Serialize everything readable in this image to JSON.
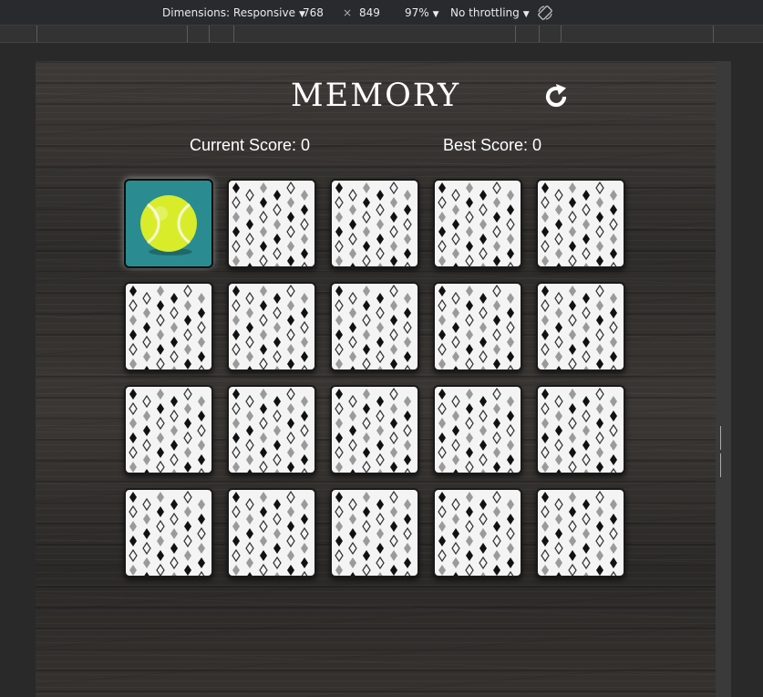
{
  "devtools": {
    "dimensions_label": "Dimensions: Responsive",
    "width": "768",
    "times": "×",
    "height": "849",
    "zoom": "97%",
    "throttling": "No throttling"
  },
  "game": {
    "title": "MEMORY",
    "current_score_label": "Current Score: 0",
    "best_score_label": "Best Score: 0",
    "restart_icon": "restart-icon",
    "cards": [
      {
        "state": "face-up",
        "image": "tennis-ball"
      },
      {
        "state": "face-down"
      },
      {
        "state": "face-down"
      },
      {
        "state": "face-down"
      },
      {
        "state": "face-down"
      },
      {
        "state": "face-down"
      },
      {
        "state": "face-down"
      },
      {
        "state": "face-down"
      },
      {
        "state": "face-down"
      },
      {
        "state": "face-down"
      },
      {
        "state": "face-down"
      },
      {
        "state": "face-down"
      },
      {
        "state": "face-down"
      },
      {
        "state": "face-down"
      },
      {
        "state": "face-down"
      },
      {
        "state": "face-down"
      },
      {
        "state": "face-down"
      },
      {
        "state": "face-down"
      },
      {
        "state": "face-down"
      },
      {
        "state": "face-down"
      }
    ]
  },
  "colors": {
    "card_face_up_bg": "#2a8c91",
    "tennis_ball": "#d9ec2a",
    "card_back": "#f4f4f4"
  }
}
